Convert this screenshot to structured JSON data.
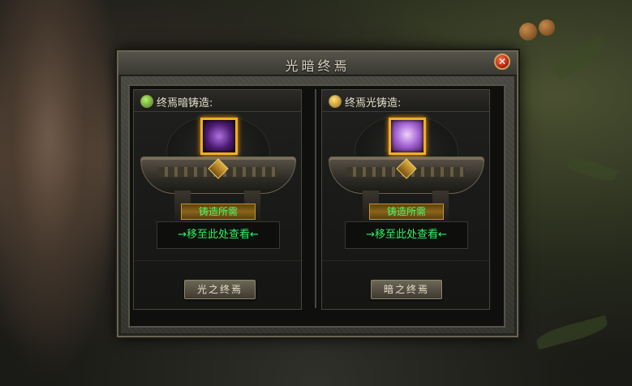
{
  "window": {
    "title": "光暗终焉",
    "close_label": "✕"
  },
  "panels": [
    {
      "header": "终焉暗铸造:",
      "icon": "green-orb-icon",
      "item": "purple-dark-crystal-icon",
      "requirement_label": "铸造所需",
      "move_hint": "→移至此处查看←",
      "button_label": "光之终焉"
    },
    {
      "header": "终焉光铸造:",
      "icon": "gold-orb-icon",
      "item": "pink-light-crystal-icon",
      "requirement_label": "铸造所需",
      "move_hint": "→移至此处查看←",
      "button_label": "暗之终焉"
    }
  ],
  "colors": {
    "hint_green": "#30f060",
    "item_frame_gold": "#f0b020",
    "close_red": "#b8250e"
  }
}
